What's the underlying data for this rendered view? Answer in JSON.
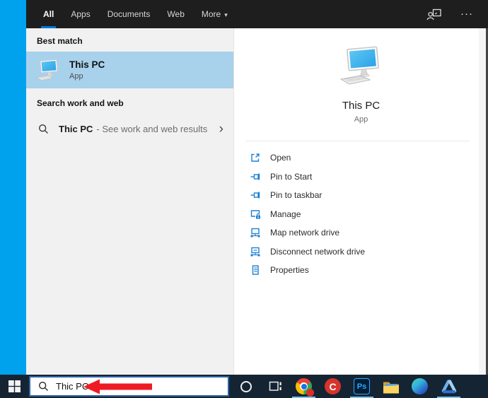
{
  "top_bar": {
    "tabs": [
      {
        "label": "All",
        "selected": true
      },
      {
        "label": "Apps",
        "selected": false
      },
      {
        "label": "Documents",
        "selected": false
      },
      {
        "label": "Web",
        "selected": false
      },
      {
        "label": "More",
        "selected": false,
        "caret": "▾"
      }
    ],
    "more_options_glyph": "···"
  },
  "left_panel": {
    "best_match_header": "Best match",
    "best_match": {
      "title": "This PC",
      "subtitle": "App",
      "icon": "this-pc-icon"
    },
    "search_web_header": "Search work and web",
    "suggestion": {
      "query": "Thic PC",
      "hint": "- See work and web results",
      "chevron": "›",
      "icon": "search-icon"
    }
  },
  "right_panel": {
    "app": {
      "title": "This PC",
      "subtitle": "App",
      "icon": "this-pc-icon"
    },
    "actions": [
      {
        "label": "Open",
        "icon": "open-icon"
      },
      {
        "label": "Pin to Start",
        "icon": "pin-icon"
      },
      {
        "label": "Pin to taskbar",
        "icon": "pin-icon"
      },
      {
        "label": "Manage",
        "icon": "manage-icon"
      },
      {
        "label": "Map network drive",
        "icon": "map-network-drive-icon"
      },
      {
        "label": "Disconnect network drive",
        "icon": "disconnect-network-drive-icon"
      },
      {
        "label": "Properties",
        "icon": "properties-icon"
      }
    ]
  },
  "taskbar": {
    "search": {
      "value": "Thic PC",
      "icon": "search-icon"
    },
    "annotation": {
      "type": "red-arrow",
      "color": "#ed1c24"
    },
    "items": [
      {
        "name": "cortana",
        "running": false
      },
      {
        "name": "task-view",
        "running": false
      },
      {
        "name": "chrome",
        "running": true,
        "has_badge": true
      },
      {
        "name": "ccleaner",
        "running": false,
        "letter": "C"
      },
      {
        "name": "photoshop",
        "running": true,
        "label": "Ps"
      },
      {
        "name": "file-explorer",
        "running": false
      },
      {
        "name": "edge",
        "running": false
      },
      {
        "name": "drive-app",
        "running": true
      }
    ]
  },
  "colors": {
    "accent": "#0078d7",
    "desktop": "#00a2ed",
    "top_bar_bg": "#1e1e1e",
    "left_panel_bg": "#f1f1f1",
    "highlight": "#a8d1ec",
    "taskbar_bg": "#152433",
    "action_icon": "#1e81d2",
    "search_border": "#2d64a7",
    "running_indicator": "#7fc1ea"
  }
}
